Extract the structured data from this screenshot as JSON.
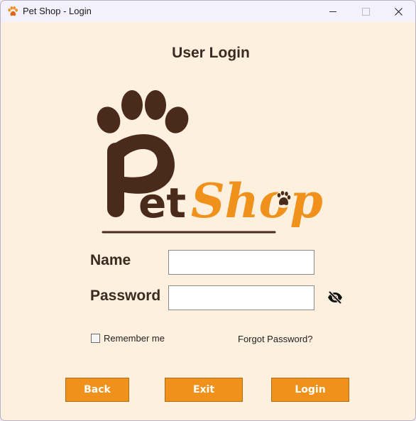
{
  "window": {
    "title": "Pet Shop - Login",
    "app_icon": "paw-icon",
    "controls": [
      "minimize-icon",
      "maximize-icon",
      "close-icon"
    ],
    "close_glyph": "✕"
  },
  "heading": "User Login",
  "logo": {
    "text_part1": "Pet",
    "text_part2": "Shop",
    "colors": {
      "brown": "#4a2a1a",
      "orange": "#f0911c"
    }
  },
  "form": {
    "name_label": "Name",
    "name_value": "",
    "password_label": "Password",
    "password_value": "",
    "eye_icon": "eye-slash-icon",
    "remember_label": "Remember me",
    "remember_checked": false,
    "forgot_label": "Forgot Password?"
  },
  "buttons": {
    "back": "Back",
    "exit": "Exit",
    "login": "Login"
  },
  "colors": {
    "background": "#fef0de",
    "accent": "#f0911c",
    "text": "#3a2a22"
  }
}
